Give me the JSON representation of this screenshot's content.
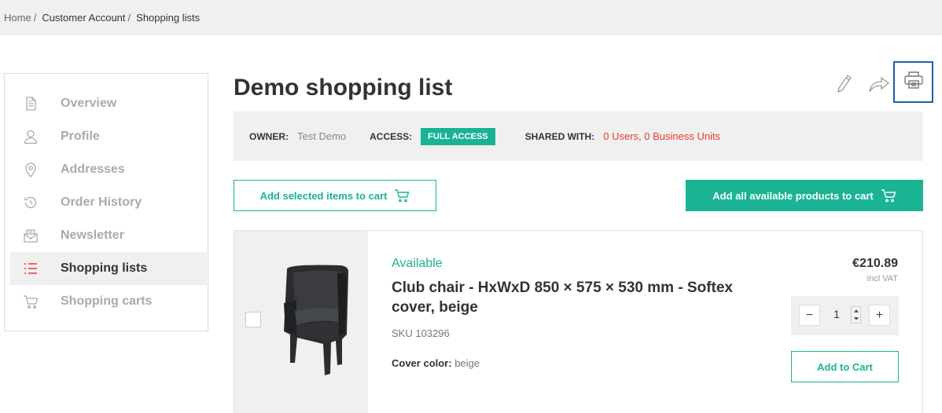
{
  "breadcrumb": [
    {
      "label": "Home"
    },
    {
      "label": "Customer Account"
    },
    {
      "label": "Shopping lists"
    }
  ],
  "breadcrumb_sep": "/",
  "sidebar": {
    "items": [
      {
        "label": "Overview",
        "icon": "document-icon",
        "active": false
      },
      {
        "label": "Profile",
        "icon": "user-icon",
        "active": false
      },
      {
        "label": "Addresses",
        "icon": "location-pin-icon",
        "active": false
      },
      {
        "label": "Order History",
        "icon": "history-icon",
        "active": false
      },
      {
        "label": "Newsletter",
        "icon": "newsletter-icon",
        "active": false
      },
      {
        "label": "Shopping lists",
        "icon": "list-icon",
        "active": true
      },
      {
        "label": "Shopping carts",
        "icon": "cart-icon",
        "active": false
      }
    ]
  },
  "page": {
    "title": "Demo shopping list"
  },
  "toolbar": {
    "edit_icon": "pencil-icon",
    "share_icon": "share-icon",
    "print_icon": "printer-icon"
  },
  "info": {
    "owner_label": "OWNER:",
    "owner_value": "Test Demo",
    "access_label": "ACCESS:",
    "access_value": "FULL ACCESS",
    "shared_label": "SHARED WITH:",
    "shared_value": "0 Users, 0 Business Units"
  },
  "actions": {
    "add_selected": "Add selected items to cart",
    "add_all": "Add all available products to cart"
  },
  "product": {
    "availability": "Available",
    "name": "Club chair - HxWxD 850 × 575 × 530 mm - Softex cover, beige",
    "sku": "SKU 103296",
    "attr_label": "Cover color:",
    "attr_value": "beige",
    "price": "€210.89",
    "vat": "incl VAT",
    "quantity": "1",
    "minus": "−",
    "plus": "+",
    "add_to_cart": "Add to Cart"
  },
  "colors": {
    "accent": "#1ab394",
    "shared_red": "#e23d2e",
    "print_outline": "#1f5fa8",
    "active_icon": "#e23d2e"
  }
}
